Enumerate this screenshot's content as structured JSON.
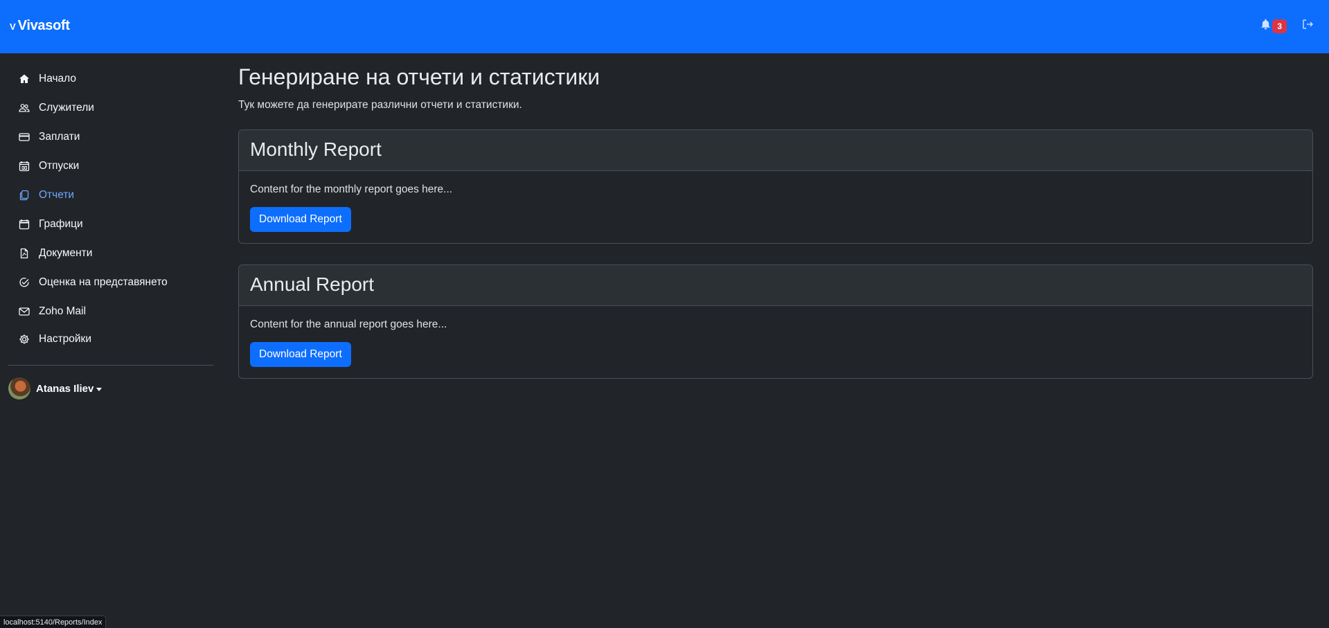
{
  "header": {
    "brand_mark": "V",
    "brand_name": "Vivasoft",
    "notification_count": "3"
  },
  "sidebar": {
    "items": [
      {
        "label": "Начало",
        "icon": "home-icon"
      },
      {
        "label": "Служители",
        "icon": "people-icon"
      },
      {
        "label": "Заплати",
        "icon": "credit-card-icon"
      },
      {
        "label": "Отпуски",
        "icon": "calendar-event-icon"
      },
      {
        "label": "Отчети",
        "icon": "files-icon",
        "active": true
      },
      {
        "label": "Графици",
        "icon": "calendar-icon"
      },
      {
        "label": "Документи",
        "icon": "document-icon"
      },
      {
        "label": "Оценка на представянето",
        "icon": "check-circle-icon"
      },
      {
        "label": "Zoho Mail",
        "icon": "envelope-icon"
      },
      {
        "label": "Настройки",
        "icon": "gear-icon"
      }
    ],
    "user": {
      "name": "Atanas Iliev"
    }
  },
  "main": {
    "title": "Генериране на отчети и статистики",
    "subtitle": "Тук можете да генерирате различни отчети и статистики.",
    "cards": [
      {
        "title": "Monthly Report",
        "text": "Content for the monthly report goes here...",
        "button": "Download Report"
      },
      {
        "title": "Annual Report",
        "text": "Content for the annual report goes here...",
        "button": "Download Report"
      }
    ]
  },
  "statusbar": {
    "url": "localhost:5140/Reports/Index"
  },
  "colors": {
    "brand": "#0d6efd",
    "background": "#212529",
    "active_link": "#6ea8fe",
    "badge": "#dc3545"
  }
}
